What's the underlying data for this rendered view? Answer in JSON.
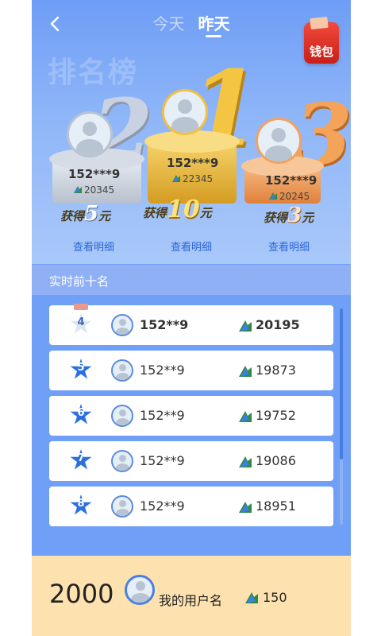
{
  "header": {
    "tabs": [
      {
        "label": "今天",
        "active": false
      },
      {
        "label": "昨天",
        "active": true
      }
    ],
    "wallet_label": "钱包",
    "watermark": "排名榜"
  },
  "podium": {
    "first": {
      "rank": "1",
      "name": "152***9",
      "score": "22345",
      "prize_prefix": "获得",
      "prize_amount": "10",
      "prize_unit": "元",
      "detail_label": "查看明细"
    },
    "second": {
      "rank": "2",
      "name": "152***9",
      "score": "20345",
      "prize_prefix": "获得",
      "prize_amount": "5",
      "prize_unit": "元",
      "detail_label": "查看明细"
    },
    "third": {
      "rank": "3",
      "name": "152***9",
      "score": "20245",
      "prize_prefix": "获得",
      "prize_amount": "3",
      "prize_unit": "元",
      "detail_label": "查看明细"
    }
  },
  "section_title": "实时前十名",
  "rows": [
    {
      "rank": "4",
      "name": "152**9",
      "score": "20195"
    },
    {
      "rank": "5",
      "name": "152**9",
      "score": "19873"
    },
    {
      "rank": "6",
      "name": "152**9",
      "score": "19752"
    },
    {
      "rank": "7",
      "name": "152**9",
      "score": "19086"
    },
    {
      "rank": "8",
      "name": "152**9",
      "score": "18951"
    }
  ],
  "me": {
    "rank": "2000",
    "name": "我的用户名",
    "score": "150"
  },
  "colors": {
    "brand_blue": "#6f9ff6",
    "gold": "#f4c542",
    "footer": "#fde2b0"
  },
  "icons": {
    "score": "sprout-arrow-icon",
    "back": "chevron-left-icon",
    "wallet": "wallet-icon"
  }
}
